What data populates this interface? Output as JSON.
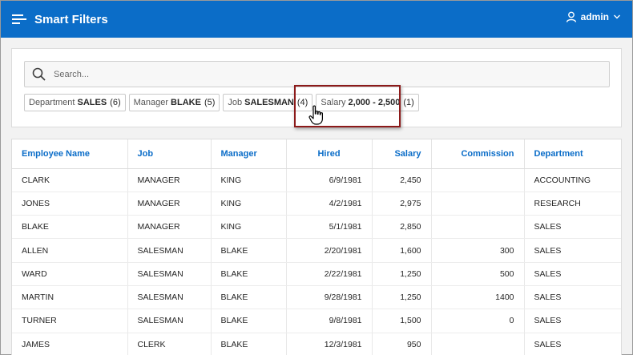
{
  "header": {
    "title": "Smart Filters",
    "user": "admin",
    "brand_color": "#0b6dc8"
  },
  "search": {
    "placeholder": "Search..."
  },
  "chips": [
    {
      "label": "Department",
      "value": "SALES",
      "count": "(6)"
    },
    {
      "label": "Manager",
      "value": "BLAKE",
      "count": "(5)"
    },
    {
      "label": "Job",
      "value": "SALESMAN",
      "count": "(4)"
    },
    {
      "label": "Salary",
      "value": "2,000 - 2,500",
      "count": "(1)"
    }
  ],
  "highlight_color": "#8c1a1a",
  "table": {
    "columns": [
      "Employee Name",
      "Job",
      "Manager",
      "Hired",
      "Salary",
      "Commission",
      "Department"
    ],
    "rows": [
      [
        "CLARK",
        "MANAGER",
        "KING",
        "6/9/1981",
        "2,450",
        "",
        "ACCOUNTING"
      ],
      [
        "JONES",
        "MANAGER",
        "KING",
        "4/2/1981",
        "2,975",
        "",
        "RESEARCH"
      ],
      [
        "BLAKE",
        "MANAGER",
        "KING",
        "5/1/1981",
        "2,850",
        "",
        "SALES"
      ],
      [
        "ALLEN",
        "SALESMAN",
        "BLAKE",
        "2/20/1981",
        "1,600",
        "300",
        "SALES"
      ],
      [
        "WARD",
        "SALESMAN",
        "BLAKE",
        "2/22/1981",
        "1,250",
        "500",
        "SALES"
      ],
      [
        "MARTIN",
        "SALESMAN",
        "BLAKE",
        "9/28/1981",
        "1,250",
        "1400",
        "SALES"
      ],
      [
        "TURNER",
        "SALESMAN",
        "BLAKE",
        "9/8/1981",
        "1,500",
        "0",
        "SALES"
      ],
      [
        "JAMES",
        "CLERK",
        "BLAKE",
        "12/3/1981",
        "950",
        "",
        "SALES"
      ]
    ]
  }
}
